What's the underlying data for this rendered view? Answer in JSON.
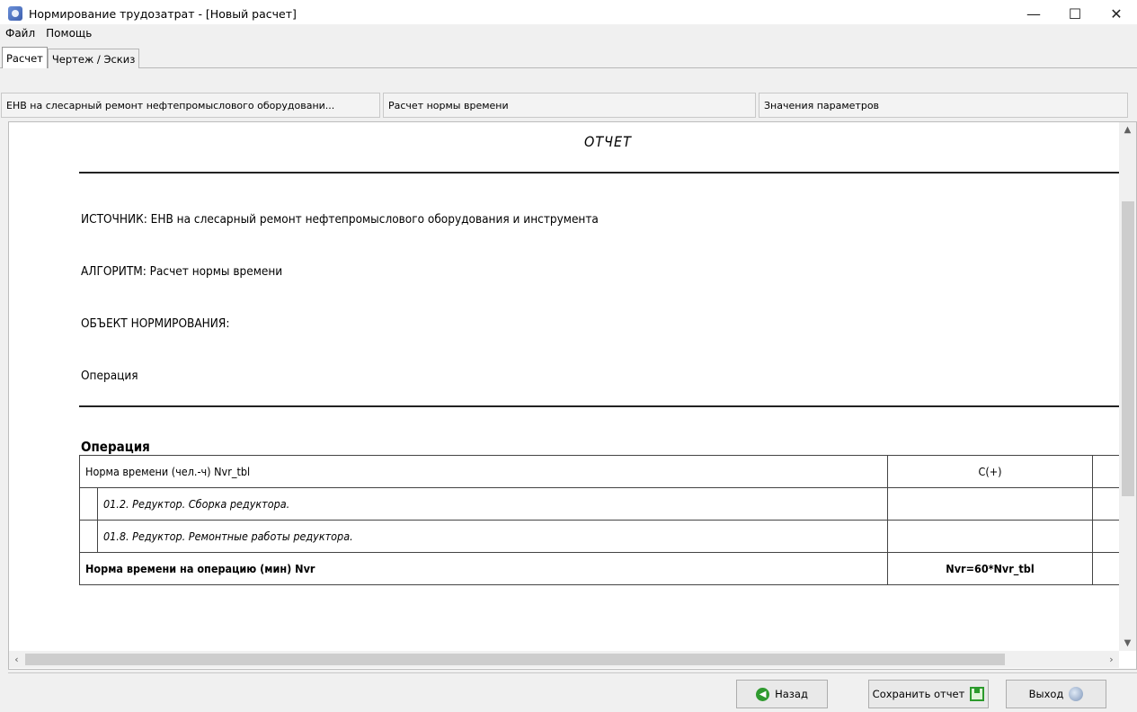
{
  "window": {
    "title": "Нормирование трудозатрат - [Новый расчет]",
    "controls": {
      "minimize": "—",
      "maximize": "☐",
      "close": "✕"
    }
  },
  "menu": {
    "items": [
      "Файл",
      "Помощь"
    ]
  },
  "tabs": [
    {
      "label": "Расчет",
      "active": true
    },
    {
      "label": "Чертеж / Эскиз",
      "active": false
    }
  ],
  "panels": {
    "source": "ЕНВ на слесарный ремонт нефтепромыслового оборудовани...",
    "algorithm": "Расчет нормы времени",
    "params": "Значения параметров"
  },
  "report": {
    "title": "ОТЧЕТ",
    "source_line": "ИСТОЧНИК: ЕНВ на слесарный ремонт нефтепромыслового оборудования и инструмента",
    "algorithm_line": "АЛГОРИТМ: Расчет нормы времени",
    "object_line": "ОБЪЕКТ НОРМИРОВАНИЯ:",
    "object_value": "Операция",
    "section_title": "Операция",
    "table": {
      "header": {
        "label": "Норма времени (чел.-ч) Nvr_tbl",
        "value": "C(+)"
      },
      "rows": [
        {
          "label": "01.2. Редуктор. Сборка редуктора.",
          "value": ""
        },
        {
          "label": "01.8. Редуктор. Ремонтные работы редуктора.",
          "value": ""
        }
      ],
      "footer": {
        "label": "Норма времени на операцию (мин) Nvr",
        "value": "Nvr=60*Nvr_tbl"
      }
    }
  },
  "buttons": {
    "back": "Назад",
    "save": "Сохранить отчет",
    "exit": "Выход"
  }
}
